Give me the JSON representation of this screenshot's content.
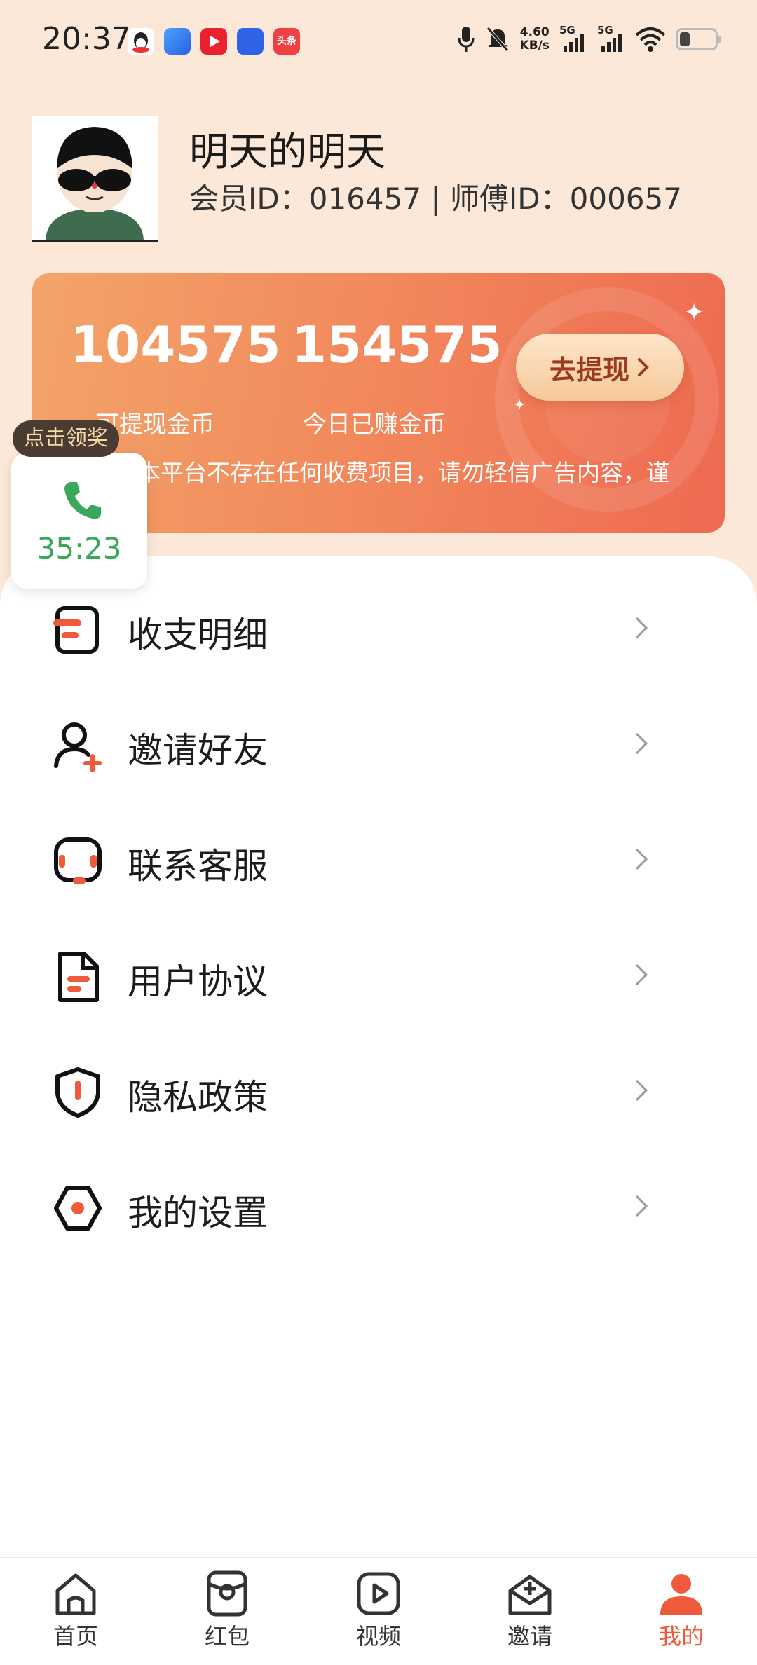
{
  "status_bar": {
    "time": "20:37",
    "net_speed_value": "4.60",
    "net_speed_unit": "KB/s",
    "signal_1": "5G",
    "signal_2": "5G",
    "app_icons": [
      "qq-icon",
      "browser-icon",
      "video-app-icon",
      "baidu-icon",
      "toutiao-icon"
    ],
    "toutiao_label": "头条"
  },
  "profile": {
    "nickname": "明天的明天",
    "ids": "会员ID：016457 | 师傅ID：000657"
  },
  "coins": {
    "withdrawable": "104575",
    "withdrawable_label": "可提现金币",
    "earned_today": "154575",
    "earned_today_label": "今日已赚金币",
    "withdraw_button": "去提现",
    "notice": "本平台不存在任何收费项目，请勿轻信广告内容，谨防诈骗"
  },
  "floating_widget": {
    "prize_label": "点击领奖",
    "timer": "35:23"
  },
  "menu": [
    {
      "label": "收支明细",
      "icon": "ledger-icon"
    },
    {
      "label": "邀请好友",
      "icon": "add-user-icon"
    },
    {
      "label": "联系客服",
      "icon": "headset-icon"
    },
    {
      "label": "用户协议",
      "icon": "document-icon"
    },
    {
      "label": "隐私政策",
      "icon": "shield-icon"
    },
    {
      "label": "我的设置",
      "icon": "settings-icon"
    }
  ],
  "bottom_nav": [
    {
      "label": "首页",
      "icon": "home-icon"
    },
    {
      "label": "红包",
      "icon": "red-packet-icon"
    },
    {
      "label": "视频",
      "icon": "video-icon"
    },
    {
      "label": "邀请",
      "icon": "invite-icon"
    },
    {
      "label": "我的",
      "icon": "profile-icon",
      "active": true
    }
  ],
  "colors": {
    "accent": "#ee5a3a",
    "card_start": "#f3a46a",
    "card_end": "#ee6a51",
    "timer_green": "#3aa85a",
    "background": "#fbe8d6"
  }
}
